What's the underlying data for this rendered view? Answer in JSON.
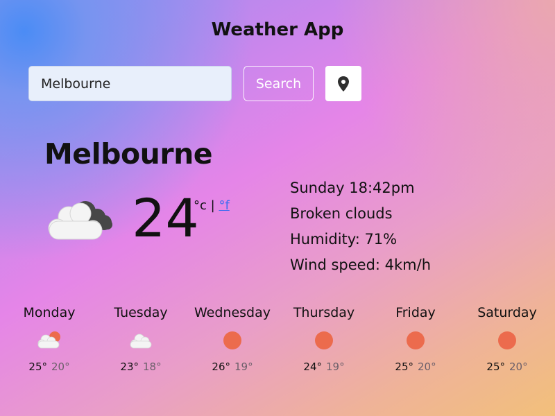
{
  "app": {
    "title": "Weather App"
  },
  "search": {
    "value": "Melbourne",
    "button_label": "Search",
    "location_icon": "map-pin-icon"
  },
  "current": {
    "city": "Melbourne",
    "icon": "cloudy-icon",
    "temperature": "24",
    "unit_c": "°c",
    "unit_separator": "|",
    "unit_f": "°f",
    "datetime": "Sunday 18:42pm",
    "description": "Broken clouds",
    "humidity": "Humidity: 71%",
    "wind": "Wind speed: 4km/h"
  },
  "forecast": [
    {
      "day": "Monday",
      "icon": "partly-cloudy-icon",
      "max": "25°",
      "min": "20°"
    },
    {
      "day": "Tuesday",
      "icon": "cloud-icon",
      "max": "23°",
      "min": "18°"
    },
    {
      "day": "Wednesday",
      "icon": "sun-icon",
      "max": "26°",
      "min": "19°"
    },
    {
      "day": "Thursday",
      "icon": "sun-icon",
      "max": "24°",
      "min": "19°"
    },
    {
      "day": "Friday",
      "icon": "sun-icon",
      "max": "25°",
      "min": "20°"
    },
    {
      "day": "Saturday",
      "icon": "sun-icon",
      "max": "25°",
      "min": "20°"
    }
  ],
  "colors": {
    "sun": "#ec6b4d",
    "link": "#3b6cf0",
    "cloud": "#f4f4f4",
    "dark_cloud": "#444444"
  }
}
